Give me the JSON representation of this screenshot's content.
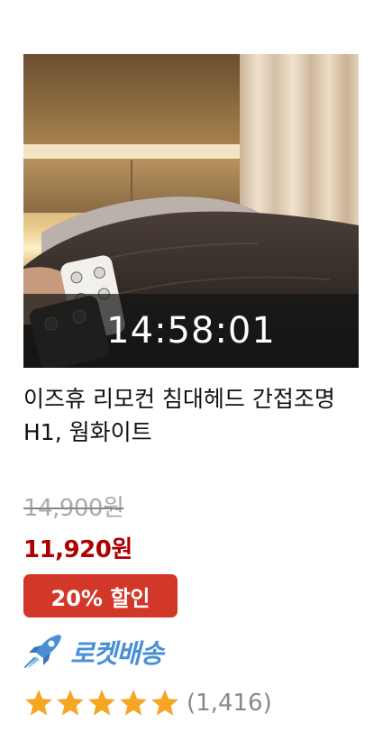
{
  "product": {
    "countdown": "14:58:01",
    "title": "이즈휴 리모컨 침대헤드 간접조명 H1, 웜화이트",
    "original_price": "14,900원",
    "sale_price": "11,920원",
    "discount_label": "20% 할인",
    "delivery_label": "로켓배송",
    "rating": 5,
    "rating_max": 5,
    "review_count": "(1,416)"
  },
  "icons": {
    "delivery": "rocket-icon",
    "rating": "star-icon"
  },
  "colors": {
    "sale_price": "#ae0000",
    "badge_bg": "#d1382a",
    "rocket": "#4a8fd6",
    "star": "#f5a623",
    "muted": "#888888"
  }
}
